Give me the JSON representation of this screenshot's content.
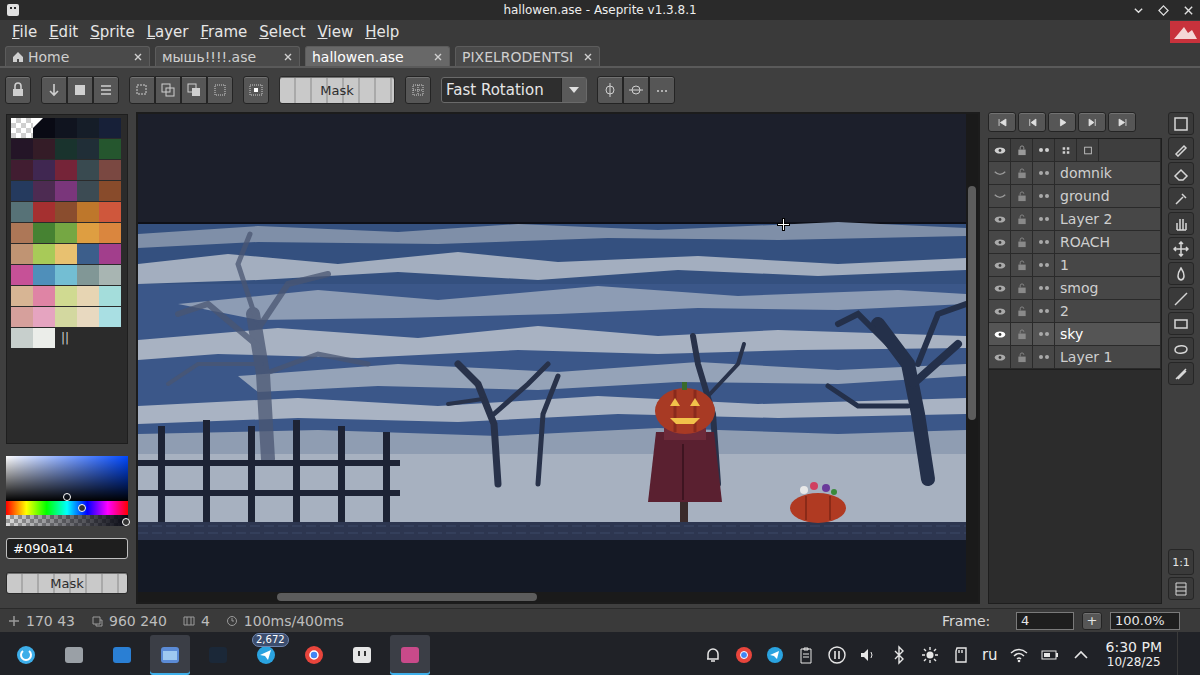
{
  "window": {
    "title": "hallowen.ase - Aseprite v1.3.8.1"
  },
  "menu": [
    "File",
    "Edit",
    "Sprite",
    "Layer",
    "Frame",
    "Select",
    "View",
    "Help"
  ],
  "tabs": [
    {
      "label": "Home",
      "selected": false,
      "kind": "home"
    },
    {
      "label": "мышь!!!!.ase",
      "selected": false,
      "kind": "file"
    },
    {
      "label": "hallowen.ase",
      "selected": true,
      "kind": "file"
    },
    {
      "label": "PIXELRODENTSI",
      "selected": false,
      "kind": "file"
    }
  ],
  "toolbar": {
    "mask_button": "Mask",
    "rotation_algorithm": "Fast Rotation"
  },
  "palette": [
    {
      "color": "#000000",
      "kind": "transparent",
      "selected": false
    },
    {
      "color": "#090a14",
      "kind": "swatch",
      "selected": true
    },
    {
      "color": "#10141f",
      "kind": "swatch",
      "selected": false
    },
    {
      "color": "#151d28",
      "kind": "swatch",
      "selected": false
    },
    {
      "color": "#172038",
      "kind": "swatch",
      "selected": false
    },
    {
      "color": "#241527",
      "kind": "swatch",
      "selected": false
    },
    {
      "color": "#341c27",
      "kind": "swatch",
      "selected": false
    },
    {
      "color": "#19332d",
      "kind": "swatch",
      "selected": false
    },
    {
      "color": "#202e37",
      "kind": "swatch",
      "selected": false
    },
    {
      "color": "#25562e",
      "kind": "swatch",
      "selected": false
    },
    {
      "color": "#411d31",
      "kind": "swatch",
      "selected": false
    },
    {
      "color": "#402751",
      "kind": "swatch",
      "selected": false
    },
    {
      "color": "#752438",
      "kind": "swatch",
      "selected": false
    },
    {
      "color": "#394a50",
      "kind": "swatch",
      "selected": false
    },
    {
      "color": "#7a4841",
      "kind": "swatch",
      "selected": false
    },
    {
      "color": "#253a5e",
      "kind": "swatch",
      "selected": false
    },
    {
      "color": "#4d2b52",
      "kind": "swatch",
      "selected": false
    },
    {
      "color": "#7a367b",
      "kind": "swatch",
      "selected": false
    },
    {
      "color": "#3c4b53",
      "kind": "swatch",
      "selected": false
    },
    {
      "color": "#884b2b",
      "kind": "swatch",
      "selected": false
    },
    {
      "color": "#577277",
      "kind": "swatch",
      "selected": false
    },
    {
      "color": "#a53030",
      "kind": "swatch",
      "selected": false
    },
    {
      "color": "#8a4d2e",
      "kind": "swatch",
      "selected": false
    },
    {
      "color": "#be772b",
      "kind": "swatch",
      "selected": false
    },
    {
      "color": "#cf573c",
      "kind": "swatch",
      "selected": false
    },
    {
      "color": "#ad7757",
      "kind": "swatch",
      "selected": false
    },
    {
      "color": "#468232",
      "kind": "swatch",
      "selected": false
    },
    {
      "color": "#75a743",
      "kind": "swatch",
      "selected": false
    },
    {
      "color": "#de9e41",
      "kind": "swatch",
      "selected": false
    },
    {
      "color": "#da863e",
      "kind": "swatch",
      "selected": false
    },
    {
      "color": "#c09473",
      "kind": "swatch",
      "selected": false
    },
    {
      "color": "#a8ca58",
      "kind": "swatch",
      "selected": false
    },
    {
      "color": "#e8c170",
      "kind": "swatch",
      "selected": false
    },
    {
      "color": "#3c5e8b",
      "kind": "swatch",
      "selected": false
    },
    {
      "color": "#a23e8c",
      "kind": "swatch",
      "selected": false
    },
    {
      "color": "#c65197",
      "kind": "swatch",
      "selected": false
    },
    {
      "color": "#4f8fba",
      "kind": "swatch",
      "selected": false
    },
    {
      "color": "#73bed3",
      "kind": "swatch",
      "selected": false
    },
    {
      "color": "#819796",
      "kind": "swatch",
      "selected": false
    },
    {
      "color": "#a8b5b2",
      "kind": "swatch",
      "selected": false
    },
    {
      "color": "#d7b594",
      "kind": "swatch",
      "selected": false
    },
    {
      "color": "#df84a5",
      "kind": "swatch",
      "selected": false
    },
    {
      "color": "#d0da91",
      "kind": "swatch",
      "selected": false
    },
    {
      "color": "#e7d5b3",
      "kind": "swatch",
      "selected": false
    },
    {
      "color": "#a4dddb",
      "kind": "swatch",
      "selected": false
    },
    {
      "color": "#d6a09c",
      "kind": "swatch",
      "selected": false
    },
    {
      "color": "#e5a4c0",
      "kind": "swatch",
      "selected": false
    },
    {
      "color": "#d3d8a0",
      "kind": "swatch",
      "selected": false
    },
    {
      "color": "#e8d9c0",
      "kind": "swatch",
      "selected": false
    },
    {
      "color": "#a9dfe3",
      "kind": "swatch",
      "selected": false
    },
    {
      "color": "#c7cfcc",
      "kind": "swatch",
      "selected": false
    },
    {
      "color": "#ebede9",
      "kind": "swatch",
      "selected": false
    }
  ],
  "palette_end_mark": "||",
  "color_picker": {
    "hex": "#090a14",
    "hue_level": 0.62,
    "saturation_level": 0.5,
    "value_level": 0.9,
    "alpha_level": 0.98
  },
  "mask_button": "Mask",
  "frame_controls": [
    {
      "action": "first"
    },
    {
      "action": "previous"
    },
    {
      "action": "play"
    },
    {
      "action": "next"
    },
    {
      "action": "last"
    }
  ],
  "layers": [
    {
      "name": "domnik",
      "visible": false,
      "selected": false
    },
    {
      "name": "ground",
      "visible": false,
      "selected": false
    },
    {
      "name": "Layer 2",
      "visible": true,
      "selected": false
    },
    {
      "name": "ROACH",
      "visible": true,
      "selected": false
    },
    {
      "name": "1",
      "visible": true,
      "selected": false
    },
    {
      "name": "smog",
      "visible": true,
      "selected": false
    },
    {
      "name": "2",
      "visible": true,
      "selected": false
    },
    {
      "name": "sky",
      "visible": true,
      "selected": true
    },
    {
      "name": "Layer 1",
      "visible": true,
      "selected": false
    }
  ],
  "scroll": {
    "vertical_start": 0.15,
    "vertical_size": 0.49,
    "horizontal_start": 0.165,
    "horizontal_size": 0.31
  },
  "tools_panel": {
    "zoom_reset": "1:1"
  },
  "status_bar": {
    "position": "170 43",
    "size": "960 240",
    "frames": "4",
    "duration": "100ms/400ms",
    "frame_label": "Frame:",
    "frame_value": "4",
    "add_frame": "+",
    "zoom": "100.0%"
  },
  "taskbar": {
    "apps": [
      {
        "active": false
      },
      {
        "active": false
      },
      {
        "active": false
      },
      {
        "active": true
      },
      {
        "active": false
      },
      {
        "active": false,
        "badge": "2,672"
      },
      {
        "active": false
      },
      {
        "active": false
      },
      {
        "active": true
      }
    ],
    "language": "ru",
    "time": "6:30 PM",
    "date": "10/28/25"
  }
}
